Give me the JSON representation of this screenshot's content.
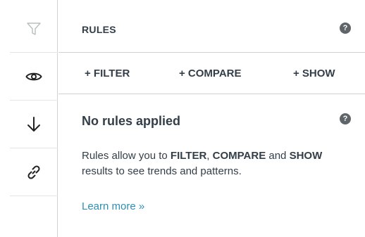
{
  "sidebar": {
    "items": [
      {
        "icon": "filter-icon"
      },
      {
        "icon": "eye-icon"
      },
      {
        "icon": "arrow-down-icon"
      },
      {
        "icon": "link-icon"
      }
    ]
  },
  "header": {
    "title": "RULES",
    "help_label": "?"
  },
  "actions": {
    "filter_label": "+ FILTER",
    "compare_label": "+ COMPARE",
    "show_label": "+ SHOW"
  },
  "content": {
    "title": "No rules applied",
    "help_label": "?",
    "description": {
      "part1": "Rules allow you to ",
      "filter": "FILTER",
      "part2": ", ",
      "compare": "COMPARE",
      "part3": " and ",
      "show": "SHOW",
      "part4": " results to see trends and patterns."
    },
    "learn_more": "Learn more »"
  },
  "colors": {
    "text": "#333e48",
    "link": "#2d8fb5",
    "help_badge": "#5f6568",
    "border": "#d0d2d3"
  }
}
